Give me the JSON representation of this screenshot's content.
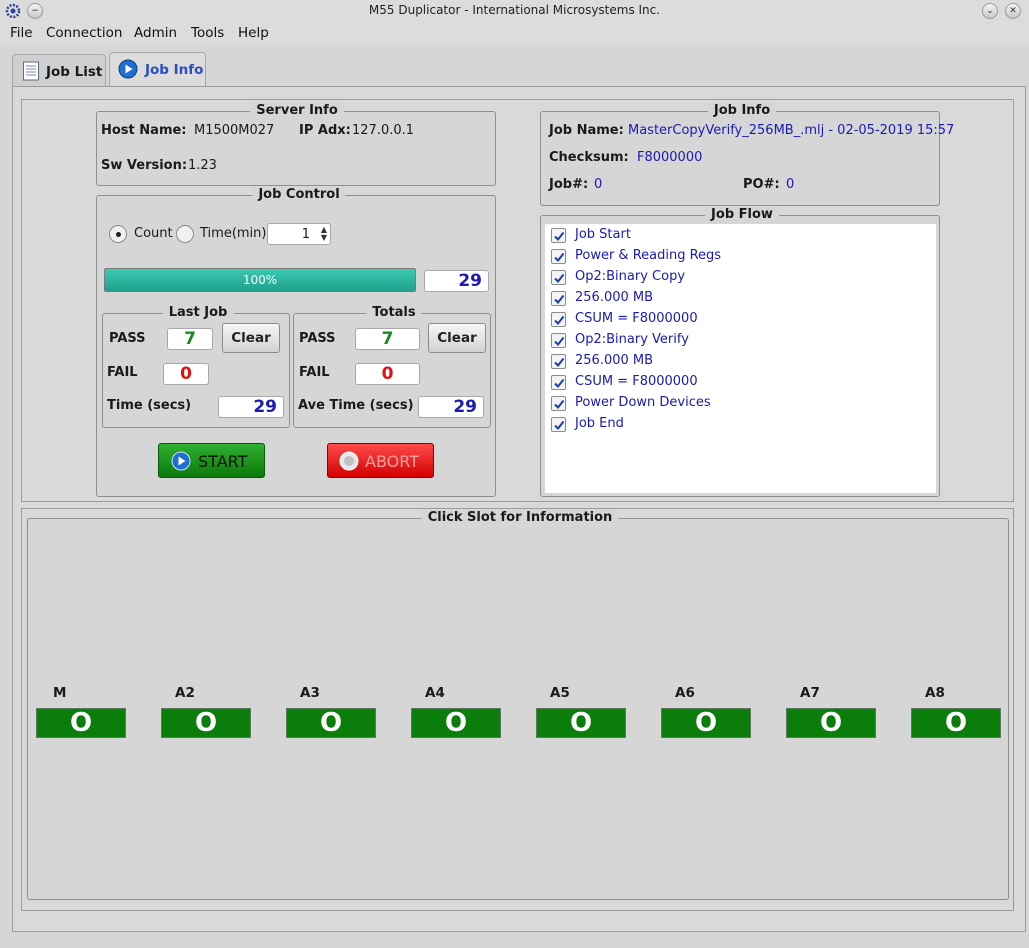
{
  "window": {
    "title": "M55 Duplicator - International Microsystems Inc."
  },
  "menu": [
    "File",
    "Connection",
    "Admin",
    "Tools",
    "Help"
  ],
  "tabs": [
    {
      "label": "Job List",
      "icon": "document-icon"
    },
    {
      "label": "Job Info",
      "icon": "play-circle-icon"
    }
  ],
  "server_info": {
    "title": "Server Info",
    "host_label": "Host Name:",
    "host_value": "M1500M027",
    "ip_label": "IP Adx:",
    "ip_value": "127.0.0.1",
    "sw_label": "Sw Version:",
    "sw_value": "1.23"
  },
  "job_control": {
    "title": "Job Control",
    "count_label": "Count",
    "time_label": "Time(min)",
    "time_value": "1",
    "progress": 100,
    "progress_text": "100%",
    "count_value": "29",
    "last_job": {
      "title": "Last Job",
      "pass_label": "PASS",
      "pass_value": "7",
      "fail_label": "FAIL",
      "fail_value": "0",
      "time_label": "Time (secs)",
      "time_value": "29",
      "clear_label": "Clear"
    },
    "totals": {
      "title": "Totals",
      "pass_label": "PASS",
      "pass_value": "7",
      "fail_label": "FAIL",
      "fail_value": "0",
      "time_label": "Ave Time (secs)",
      "time_value": "29",
      "clear_label": "Clear"
    },
    "start_label": "START",
    "abort_label": "ABORT"
  },
  "job_info": {
    "title": "Job Info",
    "name_label": "Job Name:",
    "name_value": "MasterCopyVerify_256MB_.mlj - 02-05-2019 15:57",
    "checksum_label": "Checksum:",
    "checksum_value": "F8000000",
    "job_no_label": "Job#:",
    "job_no_value": "0",
    "po_label": "PO#:",
    "po_value": "0"
  },
  "job_flow": {
    "title": "Job Flow",
    "items": [
      "Job Start",
      "Power & Reading Regs",
      "Op2:Binary Copy",
      "256.000 MB",
      "CSUM = F8000000",
      "Op2:Binary Verify",
      "256.000 MB",
      "CSUM = F8000000",
      "Power Down Devices",
      "Job End"
    ]
  },
  "slots": {
    "title": "Click Slot for Information",
    "items": [
      {
        "label": "M",
        "value": "O"
      },
      {
        "label": "A2",
        "value": "O"
      },
      {
        "label": "A3",
        "value": "O"
      },
      {
        "label": "A4",
        "value": "O"
      },
      {
        "label": "A5",
        "value": "O"
      },
      {
        "label": "A6",
        "value": "O"
      },
      {
        "label": "A7",
        "value": "O"
      },
      {
        "label": "A8",
        "value": "O"
      }
    ]
  },
  "colors": {
    "pass_green": "#1a8a1a",
    "fail_red": "#e01010",
    "count_blue": "#1a1ab4",
    "slot_green": "#0a7d0a",
    "progress_teal": "#2bb5a0"
  }
}
